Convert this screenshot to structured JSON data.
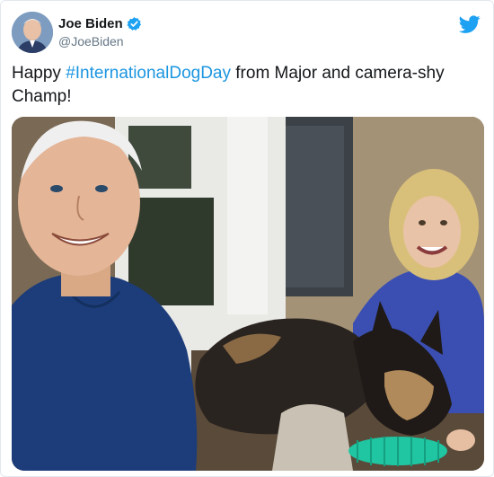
{
  "tweet": {
    "author_name": "Joe Biden",
    "author_handle": "@JoeBiden",
    "text_before": "Happy ",
    "hashtag": "#InternationalDogDay",
    "text_after": " from Major and camera-shy Champ!"
  },
  "icons": {
    "verified": "verified-badge-icon",
    "brand": "twitter-bird-icon"
  },
  "colors": {
    "hashtag": "#1b95e0",
    "verified": "#1da1f2",
    "brand": "#1da1f2",
    "text": "#14171a",
    "secondary": "#657786"
  }
}
